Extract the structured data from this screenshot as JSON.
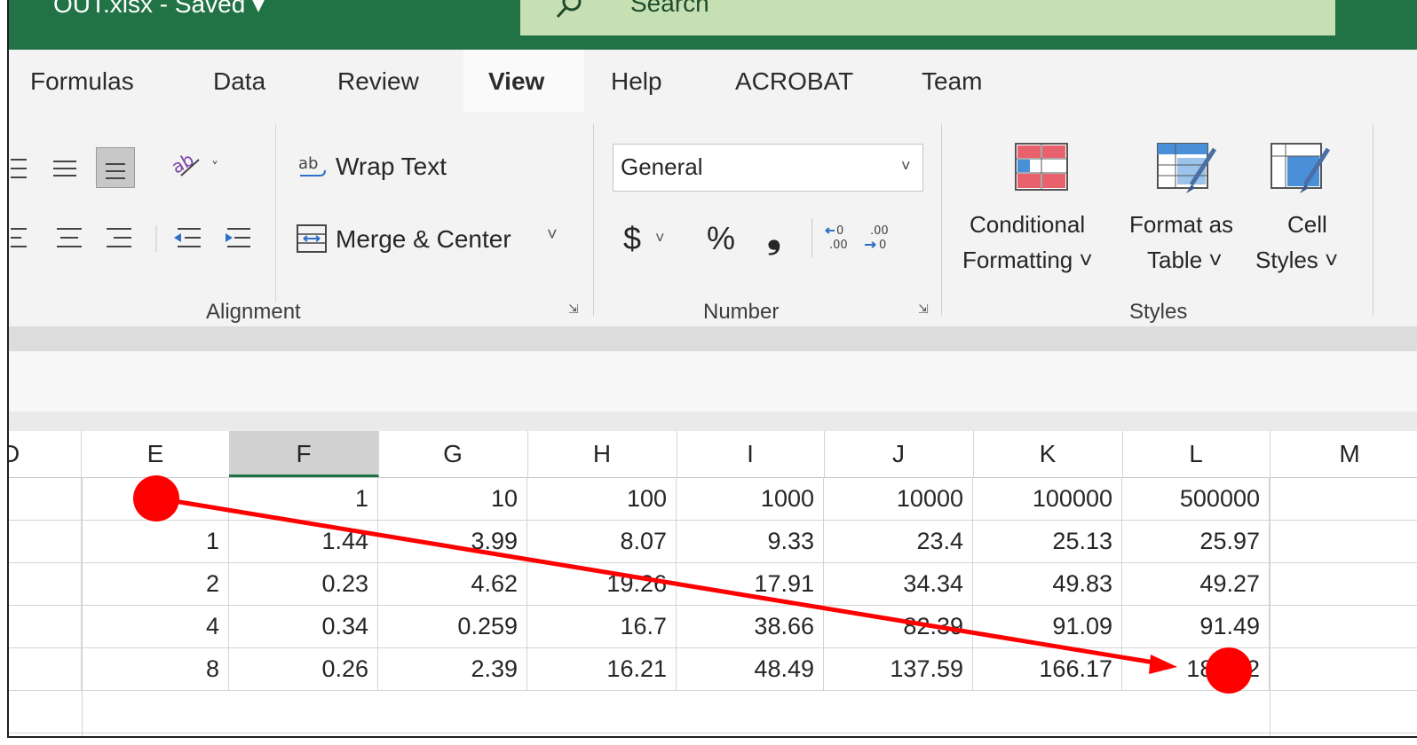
{
  "window": {
    "title": "OUT.xlsx - Saved ▾",
    "search_placeholder": "Search"
  },
  "tabs": [
    "Formulas",
    "Data",
    "Review",
    "View",
    "Help",
    "ACROBAT",
    "Team"
  ],
  "active_tab": "View",
  "ribbon": {
    "wrap_text": "Wrap Text",
    "merge_center": "Merge & Center",
    "number_format": "General",
    "currency": "$",
    "percent": "%",
    "comma": "❟",
    "cond_format_1": "Conditional",
    "cond_format_2": "Formatting ˅",
    "format_table_1": "Format as",
    "format_table_2": "Table ˅",
    "cell_styles_1": "Cell",
    "cell_styles_2": "Styles ˅",
    "groups": {
      "alignment": "Alignment",
      "number": "Number",
      "styles": "Styles"
    }
  },
  "columns": [
    "D",
    "E",
    "F",
    "G",
    "H",
    "I",
    "J",
    "K",
    "L",
    "M"
  ],
  "selected_column": "F",
  "rows": [
    [
      "",
      "",
      "1",
      "10",
      "100",
      "1000",
      "10000",
      "100000",
      "500000"
    ],
    [
      "",
      "1",
      "1.44",
      "3.99",
      "8.07",
      "9.33",
      "23.4",
      "25.13",
      "25.97"
    ],
    [
      "",
      "2",
      "0.23",
      "4.62",
      "19.26",
      "17.91",
      "34.34",
      "49.83",
      "49.27"
    ],
    [
      "",
      "4",
      "0.34",
      "0.259",
      "16.7",
      "38.66",
      "82.39",
      "91.09",
      "91.49"
    ],
    [
      "",
      "8",
      "0.26",
      "2.39",
      "16.21",
      "48.49",
      "137.59",
      "166.17",
      "180.52"
    ]
  ],
  "annotation": {
    "color": "#ff0000",
    "from": "E1",
    "to": "L5"
  }
}
